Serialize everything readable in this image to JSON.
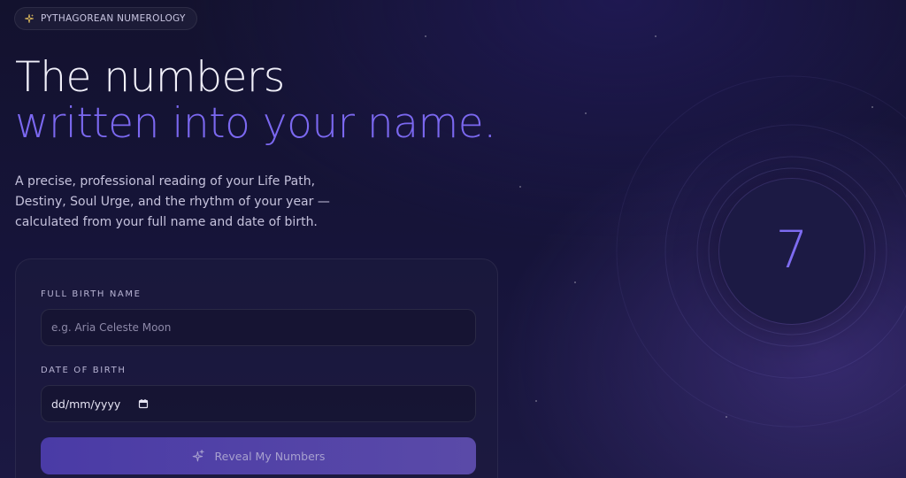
{
  "badge": {
    "text": "PYTHAGOREAN NUMEROLOGY",
    "icon": "sparkle-icon"
  },
  "hero": {
    "headline_line1": "The numbers",
    "headline_line2": "written into your name.",
    "description": "A precise, professional reading of your Life Path, Destiny, Soul Urge, and the rhythm of your year — calculated from your full name and date of birth."
  },
  "form": {
    "name_label": "FULL BIRTH NAME",
    "name_placeholder": "e.g. Aria Celeste Moon",
    "dob_label": "DATE OF BIRTH",
    "dob_value": "dd/mm/yyyy",
    "submit_label": "Reveal My Numbers"
  },
  "preview": {
    "number": "7"
  },
  "colors": {
    "accent": "#7b68f0",
    "badge_icon": "#d9b65a",
    "background": "#16143a"
  }
}
